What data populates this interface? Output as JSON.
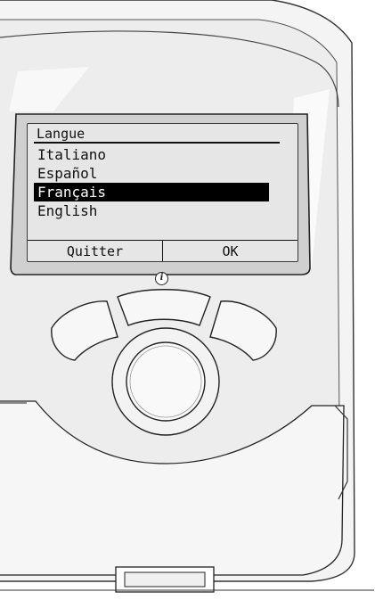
{
  "screen": {
    "title": "Langue",
    "languages": [
      {
        "label": "Italiano",
        "selected": false
      },
      {
        "label": "Español",
        "selected": false
      },
      {
        "label": "Français",
        "selected": true
      },
      {
        "label": "English",
        "selected": false
      }
    ],
    "softkeys": {
      "left": "Quitter",
      "right": "OK"
    }
  },
  "icons": {
    "info": "info-icon"
  }
}
